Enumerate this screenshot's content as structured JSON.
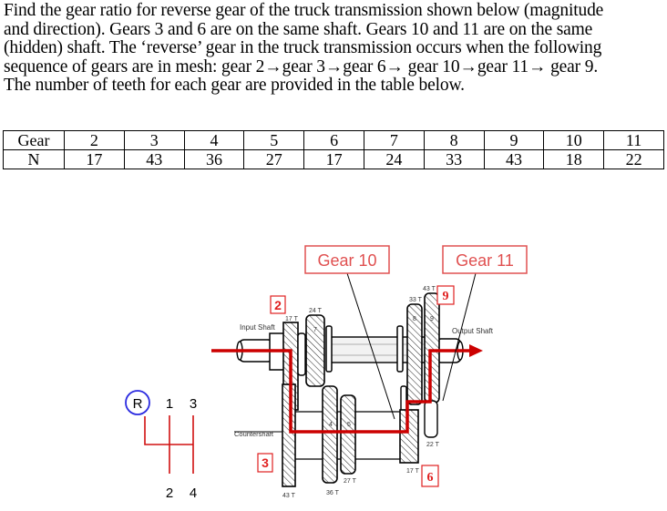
{
  "problem": {
    "lines": [
      "Find the gear ratio for reverse gear of the truck transmission shown below (magnitude",
      "and direction).  Gears 3 and 6 are on the same shaft.  Gears 10 and 11 are on the same",
      "(hidden) shaft.  The ‘reverse’ gear in the truck transmission occurs when the following",
      "sequence of gears are in mesh: gear 2→gear 3→gear 6→ gear 10→gear 11→ gear 9.",
      "The number of teeth for each gear are provided in the table below."
    ]
  },
  "table": {
    "row_labels": [
      "Gear",
      "N"
    ],
    "gears": [
      "2",
      "3",
      "4",
      "5",
      "6",
      "7",
      "8",
      "9",
      "10",
      "11"
    ],
    "teeth": [
      "17",
      "43",
      "36",
      "27",
      "17",
      "24",
      "33",
      "43",
      "18",
      "22"
    ]
  },
  "diagram": {
    "callouts": {
      "gear10": "Gear 10",
      "gear11": "Gear 11"
    },
    "gear_tags": {
      "g2": "2",
      "g3": "3",
      "g6": "6",
      "g9": "9"
    },
    "shaft_labels": {
      "input": "Input Shaft",
      "output": "Output Shaft",
      "counter": "Countershaft"
    },
    "tooth_labels": {
      "g2": "17 T",
      "g7": "24 T",
      "g8": "33 T",
      "g9": "43 T",
      "g3": "43 T",
      "g4": "36 T",
      "g5": "27 T",
      "g6": "17 T",
      "g11": "22 T"
    },
    "gear_numbers": {
      "g2": "2",
      "g7": "7",
      "g8": "8",
      "g9": "9",
      "g4": "4",
      "g5": "5"
    },
    "shift_pattern": {
      "r": "R",
      "p1": "1",
      "p3": "3",
      "p2": "2",
      "p4": "4"
    },
    "colors": {
      "power_path": "#cc0000",
      "callout": "#e05050",
      "tag": "#e02020",
      "shift_lines": "#d01010",
      "reverse_circle": "#2a2ae0"
    }
  }
}
